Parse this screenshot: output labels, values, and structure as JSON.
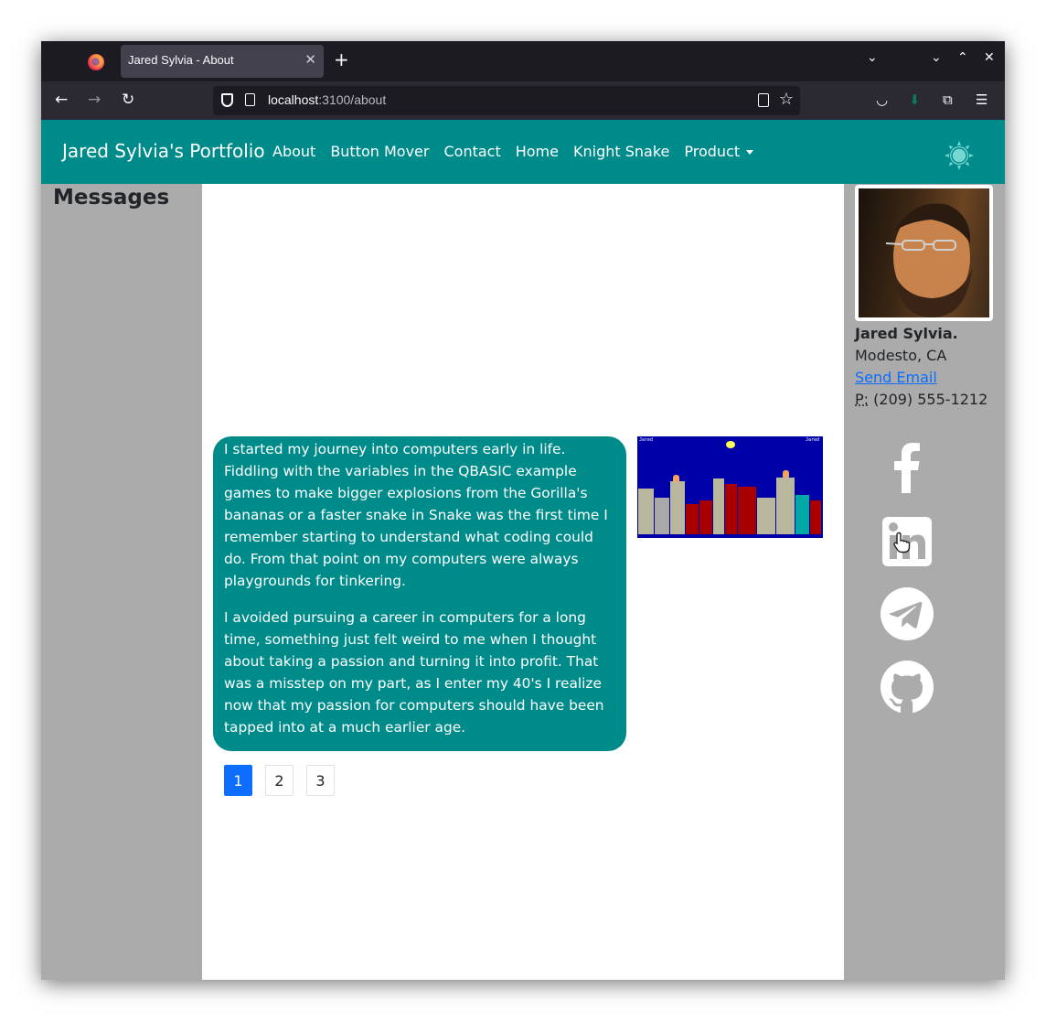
{
  "browser": {
    "tab_title": "Jared Sylvia - About",
    "url_host": "localhost",
    "url_path": ":3100/about"
  },
  "site": {
    "brand": "Jared Sylvia's Portfolio",
    "nav": [
      "About",
      "Button Mover",
      "Contact",
      "Home",
      "Knight Snake",
      "Product"
    ]
  },
  "left_sidebar": {
    "title": "Messages"
  },
  "message": {
    "paragraphs": [
      "I started my journey into computers early in life. Fiddling with the variables in the QBASIC example games to make bigger explosions from the Gorilla's bananas or a faster snake in Snake was the first time I remember starting to understand what coding could do. From that point on my computers were always playgrounds for tinkering.",
      "I avoided pursuing a career in computers for a long time, something just felt weird to me when I thought about taking a passion and turning it into profit. That was a misstep on my part, as I enter my 40's I realize now that my passion for computers should have been tapped into at a much earlier age."
    ],
    "image": {
      "label_left": "Jared",
      "label_right": "Jared"
    }
  },
  "pagination": {
    "pages": [
      "1",
      "2",
      "3"
    ],
    "active": "1"
  },
  "profile": {
    "name": "Jared Sylvia.",
    "location": "Modesto, CA",
    "email_link": "Send Email",
    "phone_label": "P:",
    "phone": "(209) 555-1212"
  },
  "social": [
    "facebook-icon",
    "linkedin-icon",
    "telegram-icon",
    "github-icon"
  ],
  "colors": {
    "accent": "#008b8b",
    "sidebar": "#ababab",
    "active_page": "#0d6efd"
  }
}
